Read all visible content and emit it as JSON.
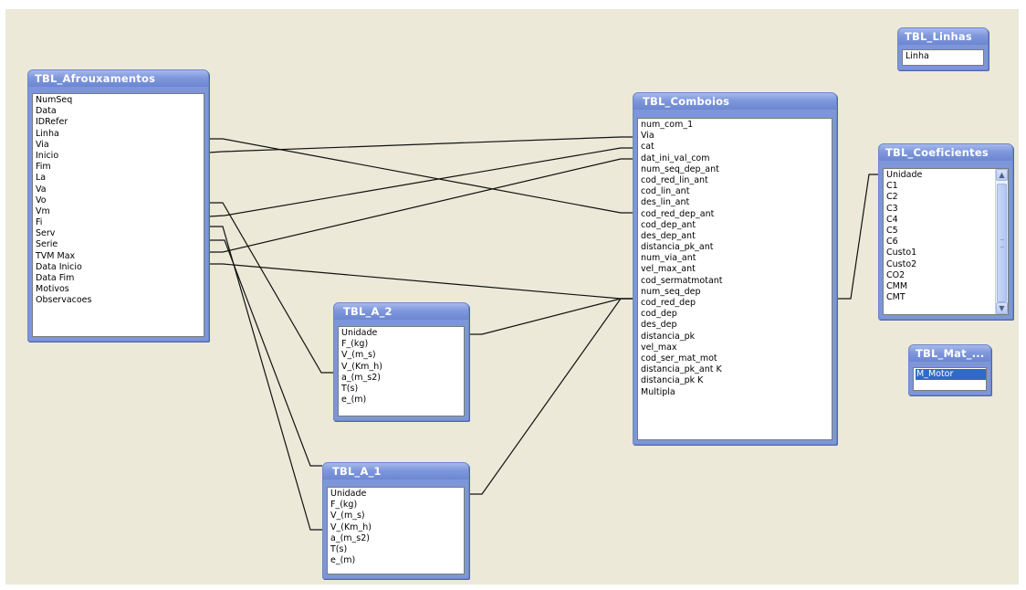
{
  "tables": {
    "afrouxamentos": {
      "title": "TBL_Afrouxamentos",
      "fields": [
        "NumSeq",
        "Data",
        "IDRefer",
        "Linha",
        "Via",
        "Inicio",
        "Fim",
        "La",
        "Va",
        "Vo",
        "Vm",
        "Fi",
        "Serv",
        "Serie",
        "TVM Max",
        "Data Inicio",
        "Data Fim",
        "Motivos",
        "Observacoes"
      ]
    },
    "comboios": {
      "title": "TBL_Comboios",
      "fields": [
        "num_com_1",
        "Via",
        "cat",
        "dat_ini_val_com",
        "num_seq_dep_ant",
        "cod_red_lin_ant",
        "cod_lin_ant",
        "des_lin_ant",
        "cod_red_dep_ant",
        "cod_dep_ant",
        "des_dep_ant",
        "distancia_pk_ant",
        "num_via_ant",
        "vel_max_ant",
        "cod_sermatmotant",
        "num_seq_dep",
        "cod_red_dep",
        "cod_dep",
        "des_dep",
        "distancia_pk",
        "vel_max",
        "cod_ser_mat_mot",
        "distancia_pk_ant K",
        "distancia_pk K",
        "Multipla"
      ]
    },
    "a2": {
      "title": "TBL_A_2",
      "fields": [
        "Unidade",
        "F_(kg)",
        "V_(m_s)",
        "V_(Km_h)",
        "a_(m_s2)",
        "T(s)",
        "e_(m)"
      ]
    },
    "a1": {
      "title": "TBL_A_1",
      "fields": [
        "Unidade",
        "F_(kg)",
        "V_(m_s)",
        "V_(Km_h)",
        "a_(m_s2)",
        "T(s)",
        "e_(m)"
      ]
    },
    "linhas": {
      "title": "TBL_Linhas",
      "fields": [
        "Linha"
      ]
    },
    "coeficientes": {
      "title": "TBL_Coeficientes",
      "fields": [
        "Unidade",
        "C1",
        "C2",
        "C3",
        "C4",
        "C5",
        "C6",
        "Custo1",
        "Custo2",
        "CO2",
        "CMM",
        "CMT"
      ]
    },
    "mat": {
      "title": "TBL_Mat_...",
      "fields": [
        "M_Motor"
      ]
    }
  },
  "icons": {
    "scroll_up": "▲",
    "scroll_down": "▼"
  }
}
